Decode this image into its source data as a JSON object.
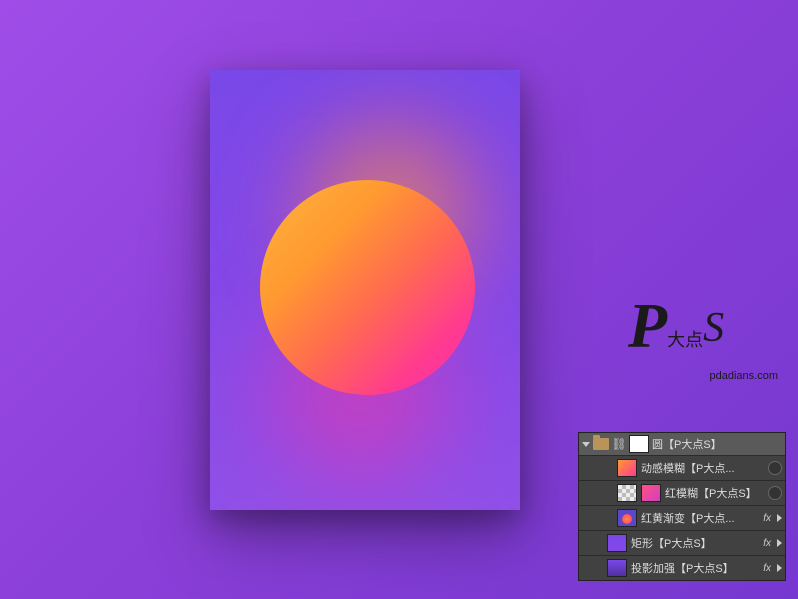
{
  "watermark": {
    "letter_p": "P",
    "letter_s": "S",
    "dots": "大点",
    "url": "pdadians.com"
  },
  "layers": {
    "group_name": "圆【P大点S】",
    "items": [
      {
        "label": "动感模糊【P大点...",
        "has_fx": false,
        "has_vis": true
      },
      {
        "label": "红模糊【P大点S】",
        "has_fx": false,
        "has_vis": true
      },
      {
        "label": "红黄渐变【P大点...",
        "has_fx": true,
        "has_vis": false
      },
      {
        "label": "矩形【P大点S】",
        "has_fx": true,
        "has_vis": false
      },
      {
        "label": "投影加强【P大点S】",
        "has_fx": true,
        "has_vis": false
      }
    ],
    "fx_label": "fx"
  }
}
